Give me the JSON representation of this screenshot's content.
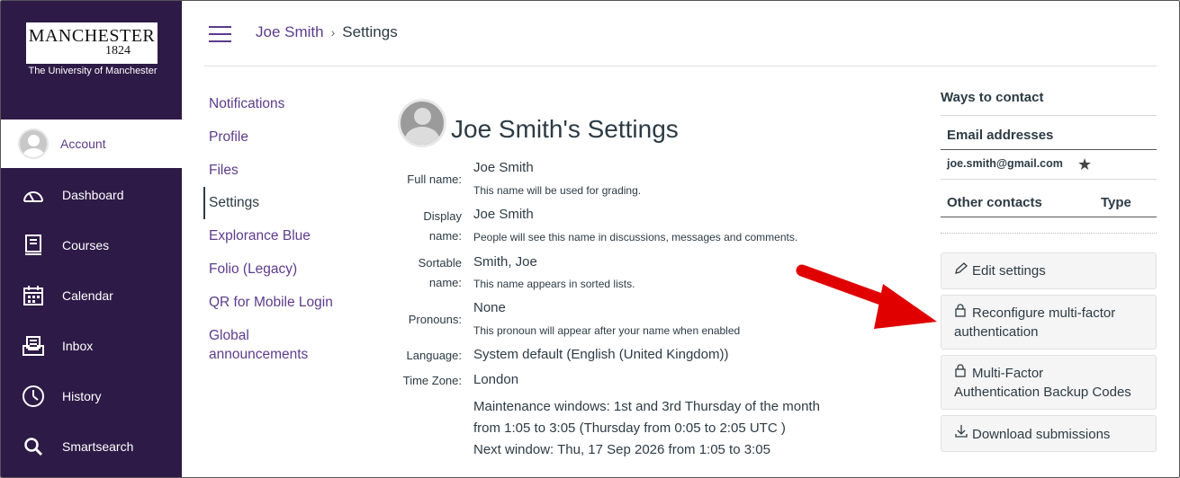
{
  "brand": {
    "name": "MANCHESTER",
    "year": "1824",
    "subtitle": "The University of Manchester"
  },
  "global_nav": [
    {
      "label": "Account",
      "icon": "avatar",
      "active": true
    },
    {
      "label": "Dashboard",
      "icon": "dashboard-icon"
    },
    {
      "label": "Courses",
      "icon": "courses-icon"
    },
    {
      "label": "Calendar",
      "icon": "calendar-icon"
    },
    {
      "label": "Inbox",
      "icon": "inbox-icon"
    },
    {
      "label": "History",
      "icon": "history-icon"
    },
    {
      "label": "Smartsearch",
      "icon": "search-icon"
    }
  ],
  "breadcrumb": {
    "user": "Joe Smith",
    "separator": "›",
    "page": "Settings"
  },
  "section_nav": [
    {
      "label": "Notifications"
    },
    {
      "label": "Profile"
    },
    {
      "label": "Files"
    },
    {
      "label": "Settings",
      "active": true
    },
    {
      "label": "Explorance Blue"
    },
    {
      "label": "Folio (Legacy)"
    },
    {
      "label": "QR for Mobile Login"
    },
    {
      "label": "Global announcements"
    }
  ],
  "main": {
    "title": "Joe Smith's Settings",
    "fields": {
      "full_name": {
        "label": "Full name:",
        "value": "Joe Smith",
        "hint": "This name will be used for grading."
      },
      "display_name": {
        "label1": "Display",
        "label2": "name:",
        "value": "Joe Smith",
        "hint": "People will see this name in discussions, messages and comments."
      },
      "sortable_name": {
        "label1": "Sortable",
        "label2": "name:",
        "value": "Smith, Joe",
        "hint": "This name appears in sorted lists."
      },
      "pronouns": {
        "label": "Pronouns:",
        "value": "None",
        "hint": "This pronoun will appear after your name when enabled"
      },
      "language": {
        "label": "Language:",
        "value": "System default (English (United Kingdom))"
      },
      "time_zone": {
        "label": "Time Zone:",
        "value": "London"
      }
    },
    "maintenance": {
      "line1": "Maintenance windows: 1st and 3rd Thursday of the month",
      "line2": "from 1:05 to 3:05 (Thursday from 0:05 to 2:05 UTC )",
      "line3": "Next window: Thu, 17 Sep 2026 from 1:05 to 3:05"
    }
  },
  "sidebar": {
    "ways_to_contact": "Ways to contact",
    "email_header": "Email addresses",
    "email": "joe.smith@gmail.com",
    "other_contacts": "Other contacts",
    "type_header": "Type",
    "buttons": {
      "edit": "Edit settings",
      "mfa_reconfigure_1": "Reconfigure multi-factor",
      "mfa_reconfigure_2": "authentication",
      "mfa_backup_1": "Multi-Factor",
      "mfa_backup_2": "Authentication Backup Codes",
      "download": "Download submissions"
    }
  },
  "colors": {
    "nav_bg": "#2e1a47",
    "link": "#5d3b8c",
    "arrow": "#e00000"
  }
}
